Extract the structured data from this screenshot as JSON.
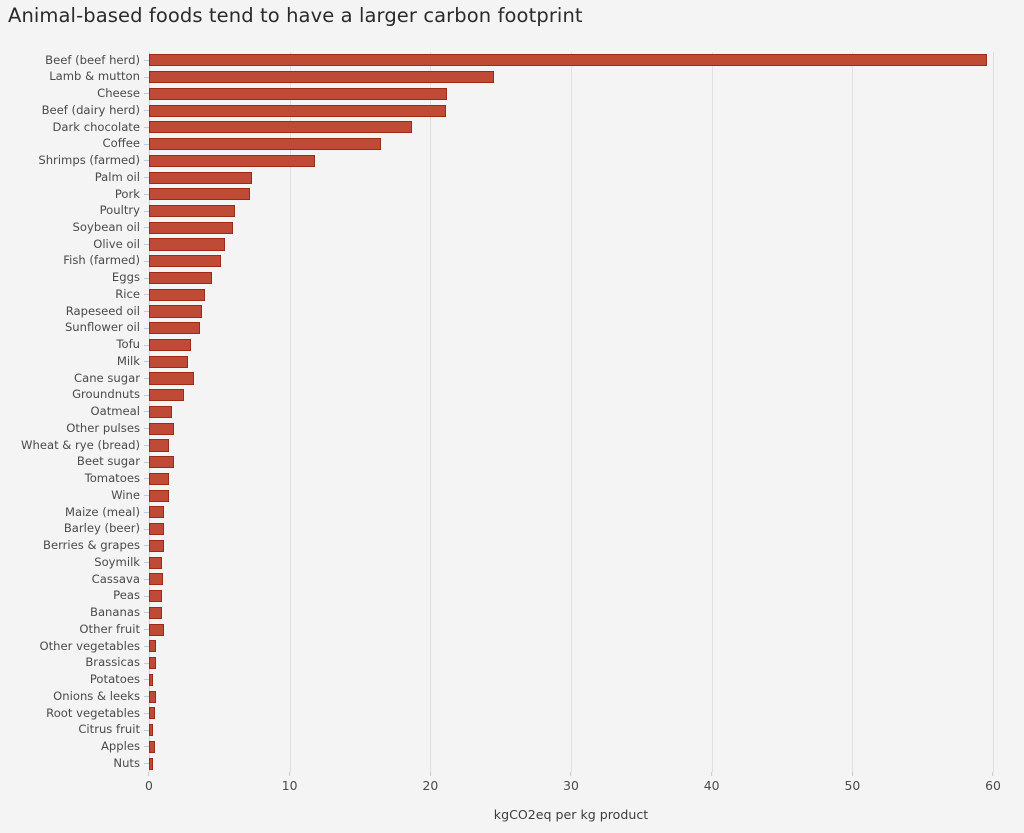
{
  "chart_data": {
    "type": "bar",
    "orientation": "horizontal",
    "title": "Animal-based foods tend to have a larger carbon footprint",
    "xlabel": "kgCO2eq per kg product",
    "ylabel": "",
    "xlim": [
      0,
      60
    ],
    "xticks": [
      0,
      10,
      20,
      30,
      40,
      50,
      60
    ],
    "xtick_labels": [
      "0",
      "10",
      "20",
      "30",
      "40",
      "50",
      "60"
    ],
    "grid": true,
    "grid_axis": "x",
    "legend": false,
    "bar_color": "#bf4b37",
    "bar_edge_color": "#9e2a16",
    "background_color": "#f4f4f4",
    "categories": [
      "Beef (beef herd)",
      "Lamb & mutton",
      "Cheese",
      "Beef (dairy herd)",
      "Dark chocolate",
      "Coffee",
      "Shrimps (farmed)",
      "Palm oil",
      "Pork",
      "Poultry",
      "Soybean oil",
      "Olive oil",
      "Fish (farmed)",
      "Eggs",
      "Rice",
      "Rapeseed oil",
      "Sunflower oil",
      "Tofu",
      "Milk",
      "Cane sugar",
      "Groundnuts",
      "Oatmeal",
      "Other pulses",
      "Wheat & rye (bread)",
      "Beet sugar",
      "Tomatoes",
      "Wine",
      "Maize (meal)",
      "Barley (beer)",
      "Berries & grapes",
      "Soymilk",
      "Cassava",
      "Peas",
      "Bananas",
      "Other fruit",
      "Other vegetables",
      "Brassicas",
      "Potatoes",
      "Onions & leeks",
      "Root vegetables",
      "Citrus fruit",
      "Apples",
      "Nuts"
    ],
    "values": [
      59.6,
      24.5,
      21.2,
      21.1,
      18.7,
      16.5,
      11.8,
      7.3,
      7.2,
      6.1,
      6.0,
      5.4,
      5.1,
      4.5,
      4.0,
      3.8,
      3.6,
      3.0,
      2.8,
      3.2,
      2.5,
      1.6,
      1.8,
      1.4,
      1.8,
      1.4,
      1.4,
      1.1,
      1.1,
      1.1,
      0.9,
      1.0,
      0.9,
      0.9,
      1.1,
      0.5,
      0.5,
      0.3,
      0.5,
      0.4,
      0.3,
      0.4,
      0.3
    ]
  }
}
